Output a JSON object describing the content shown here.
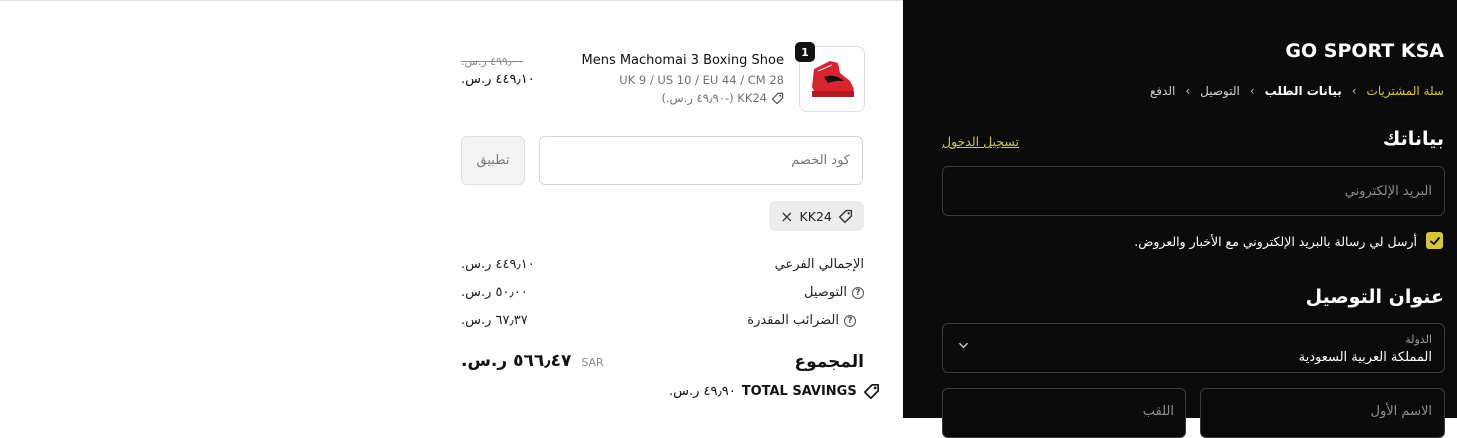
{
  "colors": {
    "panel_bg": "#0b0b0b",
    "accent": "#d6c63a",
    "shoe": "#d9232f"
  },
  "product": {
    "quantity": "1",
    "name": "Mens Machomai 3 Boxing Shoe",
    "variant": "UK 9 / US 10 / EU 44 / CM 28",
    "discount_line": "KK24 (-٤٩٫٩٠ ر.س.)",
    "old_price": "٤٩٩٫٠٠ ر.س.",
    "new_price": "٤٤٩٫١٠ ر.س.",
    "image_icon": "red-boxing-shoe-image"
  },
  "discount": {
    "placeholder": "كود الخصم",
    "apply_label": "تطبيق",
    "applied_code": "KK24"
  },
  "summary": {
    "subtotal_label": "الإجمالي الفرعي",
    "subtotal_value": "٤٤٩٫١٠ ر.س.",
    "shipping_label": "التوصيل",
    "shipping_value": "٥٠٫٠٠ ر.س.",
    "taxes_label": "الضرائب المقدرة",
    "taxes_value": "٦٧٫٣٧ ر.س.",
    "total_label": "المجموع",
    "total_currency": "SAR",
    "total_value": "٥٦٦٫٤٧ ر.س.",
    "savings_label": "TOTAL SAVINGS",
    "savings_value": "٤٩٫٩٠ ر.س."
  },
  "store": {
    "name": "GO SPORT KSA"
  },
  "breadcrumb": {
    "cart": "سلة المشتريات",
    "info": "بيانات الطلب",
    "shipping": "التوصيل",
    "payment": "الدفع"
  },
  "contact": {
    "title": "بياناتك",
    "login_link": "تسجيل الدخول",
    "email_placeholder": "البريد الإلكتروني",
    "newsletter_label": "أرسل لي رسالة بالبريد الإلكتروني مع الأخبار والعروض.",
    "newsletter_checked": true
  },
  "delivery": {
    "title": "عنوان التوصيل",
    "country_label": "الدولة",
    "country_value": "المملكة العربية السعودية",
    "first_name_placeholder": "الاسم الأول",
    "last_name_placeholder": "اللقب"
  }
}
